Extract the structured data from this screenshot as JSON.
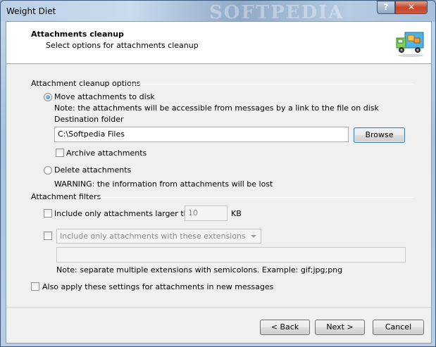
{
  "window": {
    "title": "Weight Diet",
    "watermark": "SOFTPEDIA",
    "help_label": "?",
    "close_label": "✕"
  },
  "header": {
    "title": "Attachments cleanup",
    "subtitle": "Select options for attachments cleanup",
    "icon": "moving-truck-icon"
  },
  "cleanup_options": {
    "group_label": "Attachment cleanup options",
    "move_label": "Move attachments to disk",
    "move_note": "Note: the attachments will be accessible from messages by a link to the file on disk",
    "destination_label": "Destination folder",
    "destination_value": "C:\\Softpedia Files",
    "browse_label": "Browse",
    "archive_label": "Archive attachments",
    "delete_label": "Delete attachments",
    "delete_warning": "WARNING: the information from attachments will be lost"
  },
  "filters": {
    "group_label": "Attachment filters",
    "larger_label": "Include only attachments larger than",
    "larger_value": "10",
    "larger_unit": "KB",
    "extensions_select": "Include only attachments with these extensions",
    "extensions_value": "",
    "extensions_note": "Note: separate multiple extensions with semicolons. Example: gif;jpg;png"
  },
  "apply_new_label": "Also apply these settings for attachments in new messages",
  "footer": {
    "back_label": "< Back",
    "next_label": "Next >",
    "cancel_label": "Cancel"
  }
}
